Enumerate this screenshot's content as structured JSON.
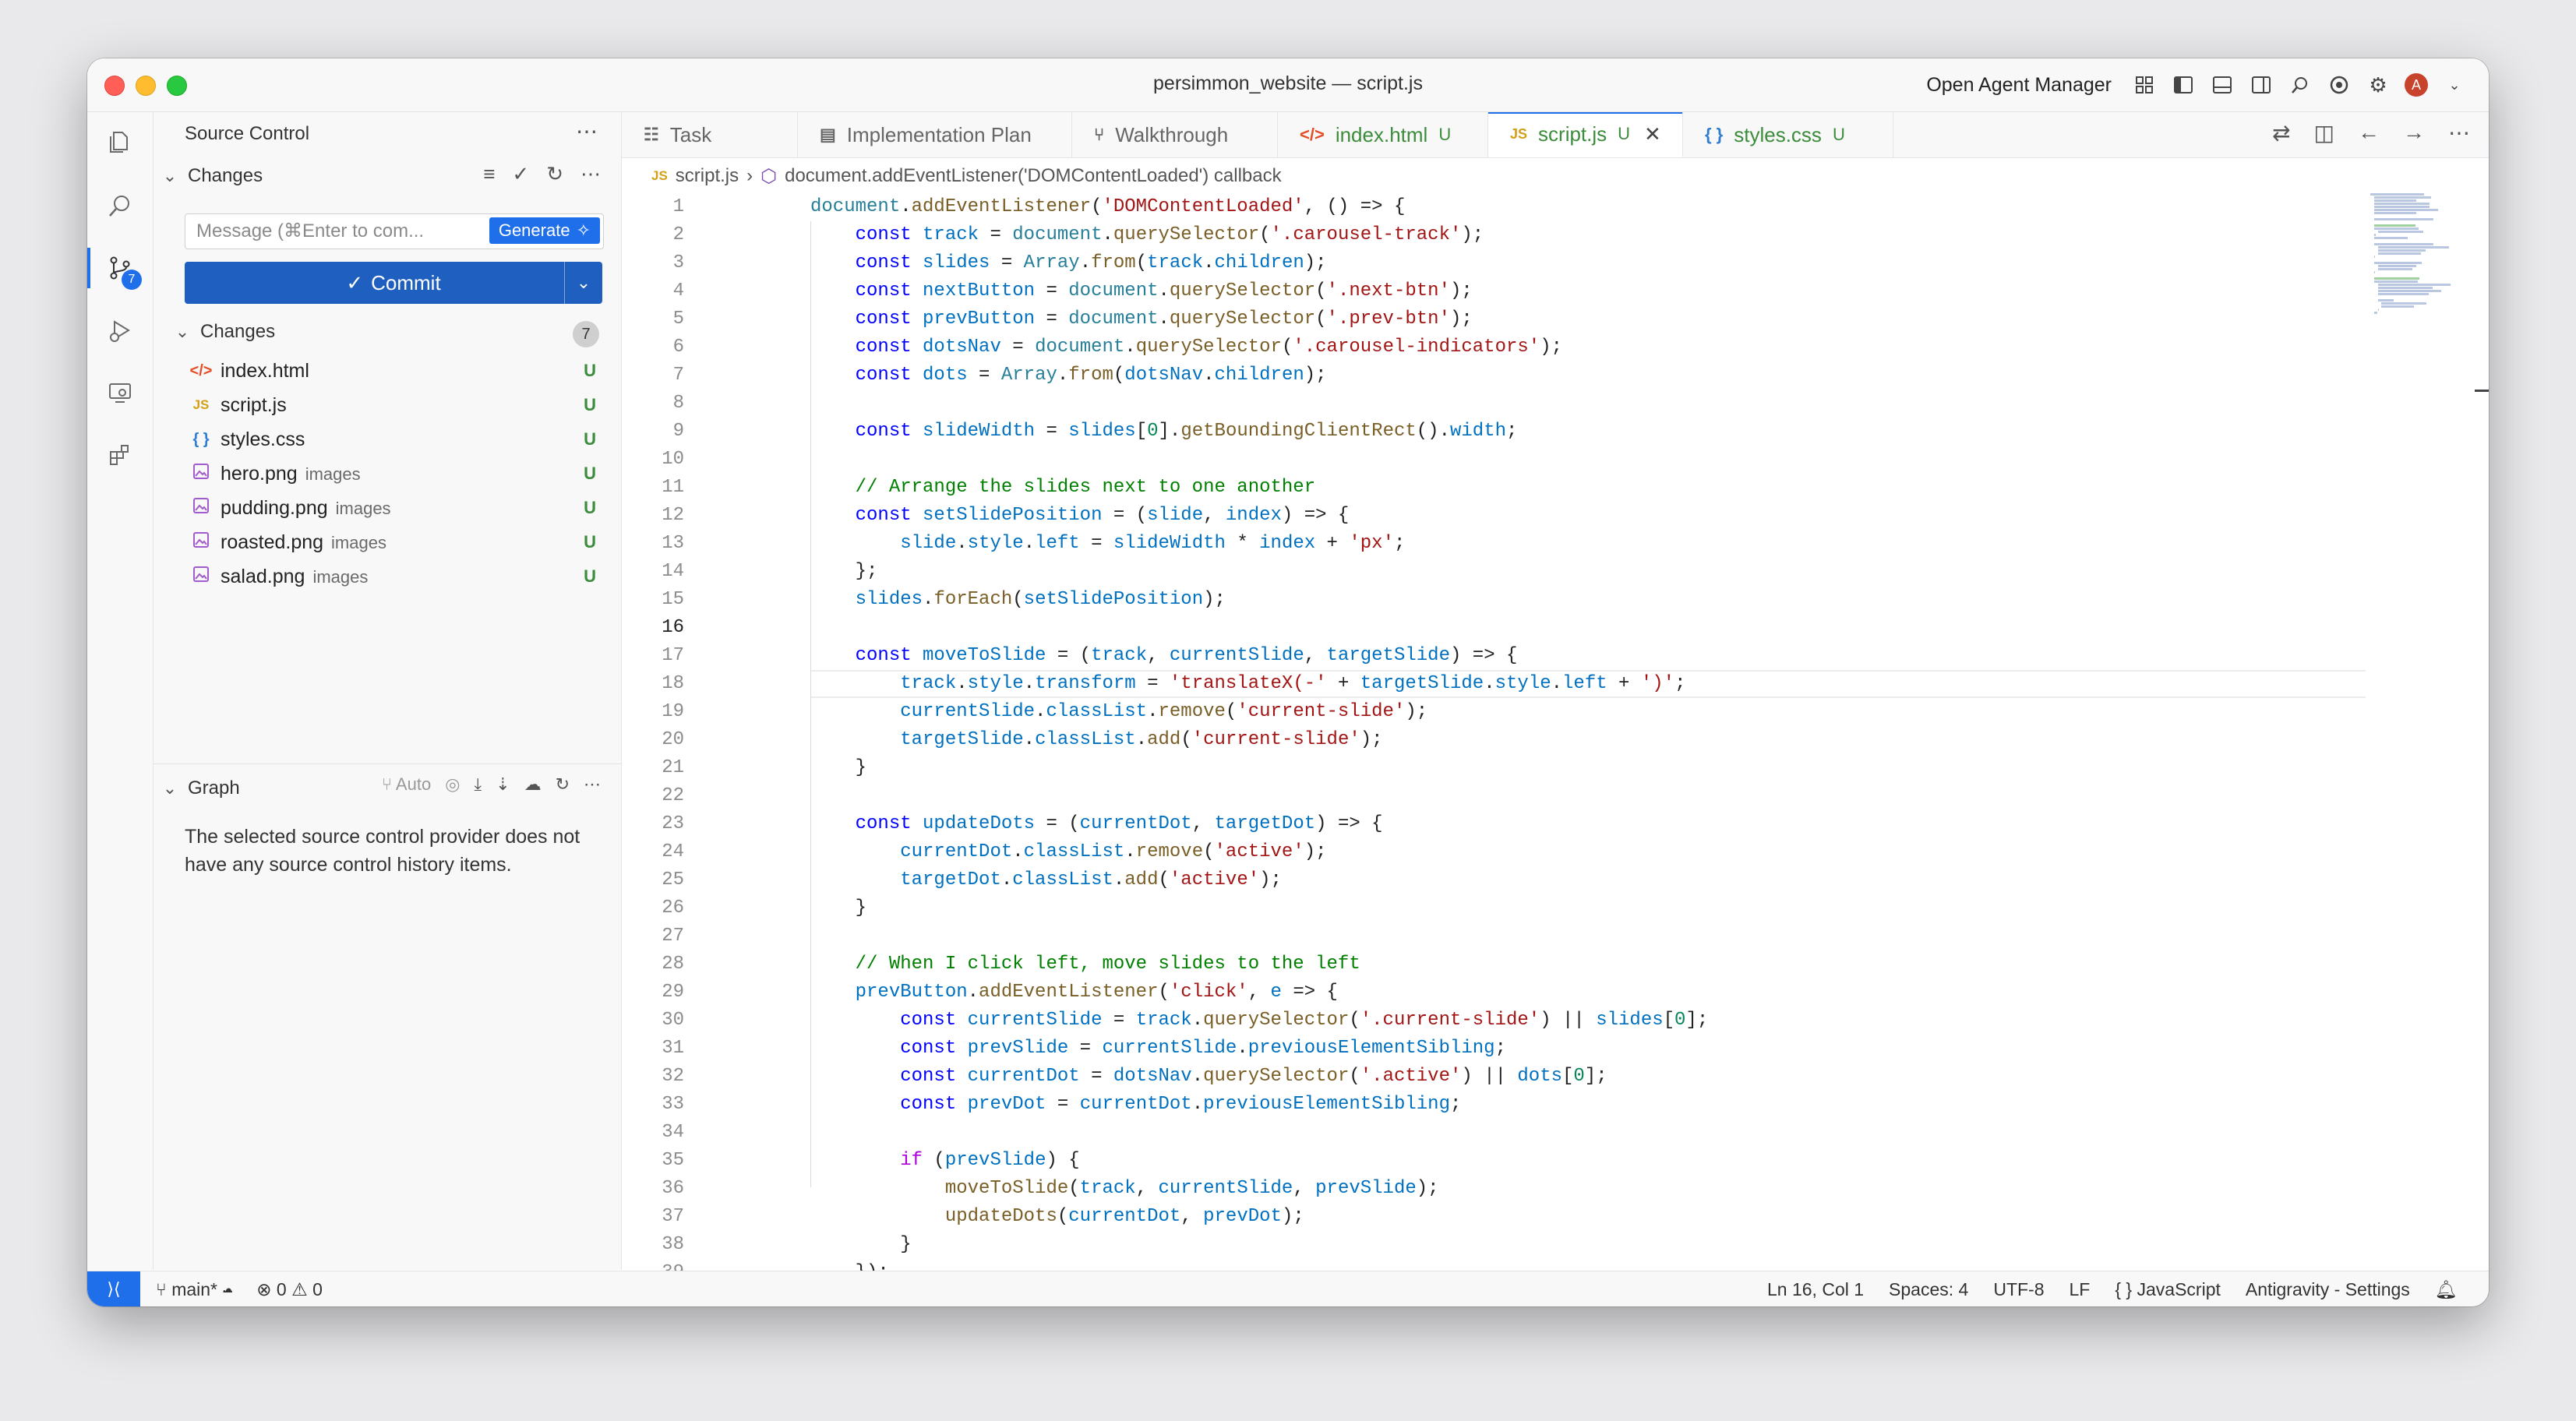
{
  "window": {
    "title": "persimmon_website — script.js",
    "agent_manager": "Open Agent Manager",
    "avatar_letter": "A"
  },
  "activity": {
    "scm_badge": "7"
  },
  "sidebar": {
    "header": "Source Control",
    "changes_section": "Changes",
    "message_placeholder": "Message (⌘Enter to com...",
    "generate_label": "Generate",
    "commit_label": "Commit",
    "changes_group": "Changes",
    "changes_count": "7",
    "files": [
      {
        "name": "index.html",
        "dir": "",
        "status": "U",
        "icon": "html-icon"
      },
      {
        "name": "script.js",
        "dir": "",
        "status": "U",
        "icon": "js-icon"
      },
      {
        "name": "styles.css",
        "dir": "",
        "status": "U",
        "icon": "css-icon"
      },
      {
        "name": "hero.png",
        "dir": "images",
        "status": "U",
        "icon": "image-icon"
      },
      {
        "name": "pudding.png",
        "dir": "images",
        "status": "U",
        "icon": "image-icon"
      },
      {
        "name": "roasted.png",
        "dir": "images",
        "status": "U",
        "icon": "image-icon"
      },
      {
        "name": "salad.png",
        "dir": "images",
        "status": "U",
        "icon": "image-icon"
      }
    ],
    "graph_title": "Graph",
    "graph_auto": "Auto",
    "graph_message": "The selected source control provider does not have any source control history items."
  },
  "tabs": [
    {
      "label": "Task",
      "status": ""
    },
    {
      "label": "Implementation Plan",
      "status": ""
    },
    {
      "label": "Walkthrough",
      "status": ""
    },
    {
      "label": "index.html",
      "status": "U"
    },
    {
      "label": "script.js",
      "status": "U"
    },
    {
      "label": "styles.css",
      "status": "U"
    }
  ],
  "breadcrumb": {
    "file": "script.js",
    "symbol": "document.addEventListener('DOMContentLoaded') callback"
  },
  "code_lines": [
    "document.addEventListener('DOMContentLoaded', () => {",
    "    const track = document.querySelector('.carousel-track');",
    "    const slides = Array.from(track.children);",
    "    const nextButton = document.querySelector('.next-btn');",
    "    const prevButton = document.querySelector('.prev-btn');",
    "    const dotsNav = document.querySelector('.carousel-indicators');",
    "    const dots = Array.from(dotsNav.children);",
    "",
    "    const slideWidth = slides[0].getBoundingClientRect().width;",
    "",
    "    // Arrange the slides next to one another",
    "    const setSlidePosition = (slide, index) => {",
    "        slide.style.left = slideWidth * index + 'px';",
    "    };",
    "    slides.forEach(setSlidePosition);",
    "",
    "    const moveToSlide = (track, currentSlide, targetSlide) => {",
    "        track.style.transform = 'translateX(-' + targetSlide.style.left + ')';",
    "        currentSlide.classList.remove('current-slide');",
    "        targetSlide.classList.add('current-slide');",
    "    }",
    "",
    "    const updateDots = (currentDot, targetDot) => {",
    "        currentDot.classList.remove('active');",
    "        targetDot.classList.add('active');",
    "    }",
    "",
    "    // When I click left, move slides to the left",
    "    prevButton.addEventListener('click', e => {",
    "        const currentSlide = track.querySelector('.current-slide') || slides[0];",
    "        const prevSlide = currentSlide.previousElementSibling;",
    "        const currentDot = dotsNav.querySelector('.active') || dots[0];",
    "        const prevDot = currentDot.previousElementSibling;",
    "",
    "        if (prevSlide) {",
    "            moveToSlide(track, currentSlide, prevSlide);",
    "            updateDots(currentDot, prevDot);",
    "        }",
    "    });"
  ],
  "current_line": 16,
  "status": {
    "branch": "main*",
    "errors": "0",
    "warnings": "0",
    "position": "Ln 16, Col 1",
    "spaces": "Spaces: 4",
    "encoding": "UTF-8",
    "eol": "LF",
    "language": "JavaScript",
    "settings": "Antigravity - Settings"
  },
  "colors": {
    "accent": "#1f6feb",
    "untracked": "#3c8c3c"
  }
}
